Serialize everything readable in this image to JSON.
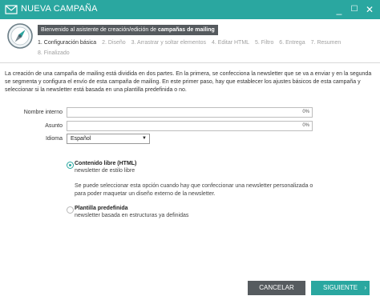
{
  "window": {
    "title": "NUEVA CAMPAÑA",
    "minimize": "_",
    "maximize": "☐",
    "close": "✕"
  },
  "header": {
    "crumb_prefix": "Bienvenido al asistente de creación/edición de",
    "crumb_bold": "campañas de mailing",
    "steps": [
      "1. Configuración básica",
      "2. Diseño",
      "3. Arrastrar y soltar elementos",
      "4. Editar HTML",
      "5. Filtro",
      "6. Entrega",
      "7. Resumen",
      "8. Finalizado"
    ]
  },
  "intro": "La creación de una campaña de mailing está dividida en dos partes. En la primera, se confecciona la newsletter que se va a enviar y en la segunda se segmenta y configura el envío de esta campaña de mailing. En este primer paso, hay que establecer los ajustes básicos de esta campaña y seleccionar si la newsletter está basada en una plantilla predefinida o no.",
  "form": {
    "internal_name_label": "Nombre interno",
    "internal_name_value": "",
    "internal_name_pct": "0%",
    "subject_label": "Asunto",
    "subject_value": "",
    "subject_pct": "0%",
    "language_label": "Idioma",
    "language_value": "Español"
  },
  "options": {
    "free": {
      "title": "Contenido libre (HTML)",
      "subtitle": "newsletter de estilo libre",
      "description": "Se puede seleccionar esta opción cuando hay que confeccionar una newsletter personalizada o para poder maquetar un diseño externo de la newsletter.",
      "selected": true
    },
    "template": {
      "title": "Plantilla predefinida",
      "subtitle": "newsletter basada en estructuras ya definidas",
      "selected": false
    }
  },
  "buttons": {
    "cancel": "CANCELAR",
    "next": "SIGUIENTE",
    "next_arrow": "›"
  },
  "colors": {
    "accent": "#2aa7a0",
    "dark_button": "#565b5f"
  }
}
